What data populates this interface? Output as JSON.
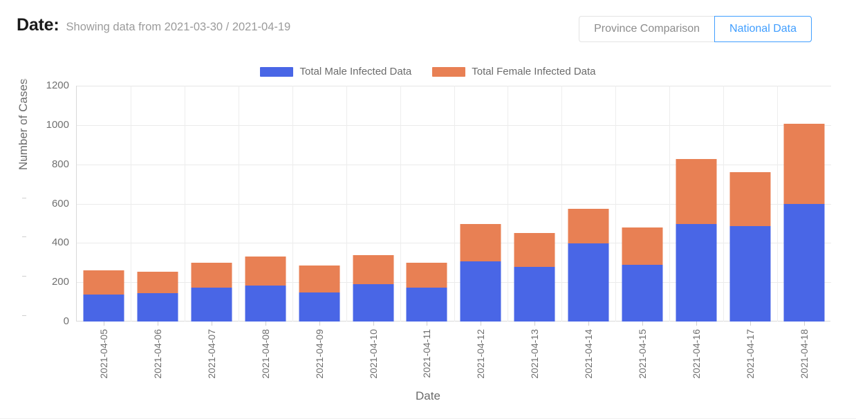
{
  "header": {
    "date_label": "Date:",
    "date_range_text": "Showing data from 2021-03-30 / 2021-04-19",
    "buttons": [
      {
        "label": "Province Comparison",
        "active": false
      },
      {
        "label": "National Data",
        "active": true
      }
    ]
  },
  "colors": {
    "male": "#4966e6",
    "female": "#e88054",
    "accent": "#409eff",
    "axis_text": "#6f6f6f",
    "grid": "#eaeaea"
  },
  "chart_data": {
    "type": "bar",
    "stacked": true,
    "title": "",
    "xlabel": "Date",
    "ylabel": "Number of Cases",
    "ylim": [
      0,
      1200
    ],
    "yticks": [
      0,
      200,
      400,
      600,
      800,
      1000,
      1200
    ],
    "grid": true,
    "legend_position": "top-center",
    "categories": [
      "2021-04-05",
      "2021-04-06",
      "2021-04-07",
      "2021-04-08",
      "2021-04-09",
      "2021-04-10",
      "2021-04-11",
      "2021-04-12",
      "2021-04-13",
      "2021-04-14",
      "2021-04-15",
      "2021-04-16",
      "2021-04-17",
      "2021-04-18"
    ],
    "series": [
      {
        "name": "Total Male Infected Data",
        "color": "#4966e6",
        "values": [
          137,
          144,
          172,
          183,
          148,
          190,
          172,
          306,
          278,
          398,
          288,
          496,
          486,
          598
        ]
      },
      {
        "name": "Total Female Infected Data",
        "color": "#e88054",
        "values": [
          123,
          109,
          127,
          148,
          137,
          148,
          127,
          190,
          172,
          175,
          190,
          331,
          274,
          408
        ]
      }
    ],
    "totals": [
      260,
      253,
      299,
      331,
      285,
      338,
      299,
      496,
      450,
      573,
      478,
      827,
      760,
      1006
    ]
  }
}
